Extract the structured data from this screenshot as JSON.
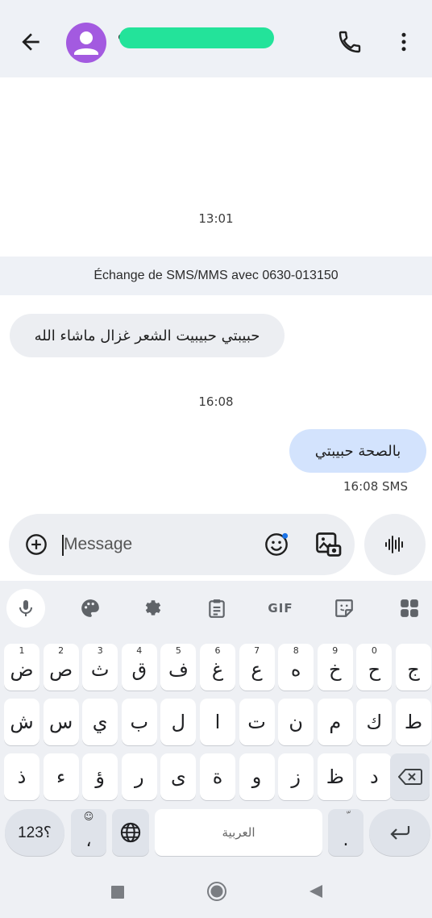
{
  "header": {
    "back_icon": "arrow-left-icon",
    "avatar_icon": "person-icon",
    "avatar_color": "#a35ae0",
    "redaction_color": "#23e39a",
    "call_icon": "phone-icon",
    "menu_icon": "more-vert-icon"
  },
  "conversation": {
    "timestamp_1": "13:01",
    "info": "Échange de SMS/MMS avec 0630-013150",
    "incoming_message": "حبيبتي حبيبيت الشعر غزال ماشاء الله",
    "timestamp_2": "16:08",
    "outgoing_message": "بالصحة حبيبتي",
    "outgoing_meta": "16:08 SMS",
    "incoming_bubble_color": "#eceef2",
    "outgoing_bubble_color": "#d3e3fd"
  },
  "composer": {
    "placeholder": "Message",
    "add_icon": "add-circle-icon",
    "emoji_icon": "emoji-icon",
    "gallery_icon": "gallery-icon",
    "voice_icon": "waveform-icon"
  },
  "keyboard": {
    "toolbar": {
      "gif_label": "GIF"
    },
    "row1": [
      {
        "key": "ض",
        "hint": "1"
      },
      {
        "key": "ص",
        "hint": "2"
      },
      {
        "key": "ث",
        "hint": "3"
      },
      {
        "key": "ق",
        "hint": "4"
      },
      {
        "key": "ف",
        "hint": "5"
      },
      {
        "key": "غ",
        "hint": "6"
      },
      {
        "key": "ع",
        "hint": "7"
      },
      {
        "key": "ه",
        "hint": "8"
      },
      {
        "key": "خ",
        "hint": "9"
      },
      {
        "key": "ح",
        "hint": "0"
      },
      {
        "key": "ج",
        "hint": ""
      }
    ],
    "row2": [
      "ش",
      "س",
      "ي",
      "ب",
      "ل",
      "ا",
      "ت",
      "ن",
      "م",
      "ك",
      "ط"
    ],
    "row3": [
      "ذ",
      "ء",
      "ؤ",
      "ر",
      "ى",
      "ة",
      "و",
      "ز",
      "ظ",
      "د"
    ],
    "symbols_label": "؟123",
    "comma_key": "،",
    "comma_hint": "☺",
    "space_label": "العربية",
    "period_key": ".",
    "period_hint": "ّ"
  }
}
